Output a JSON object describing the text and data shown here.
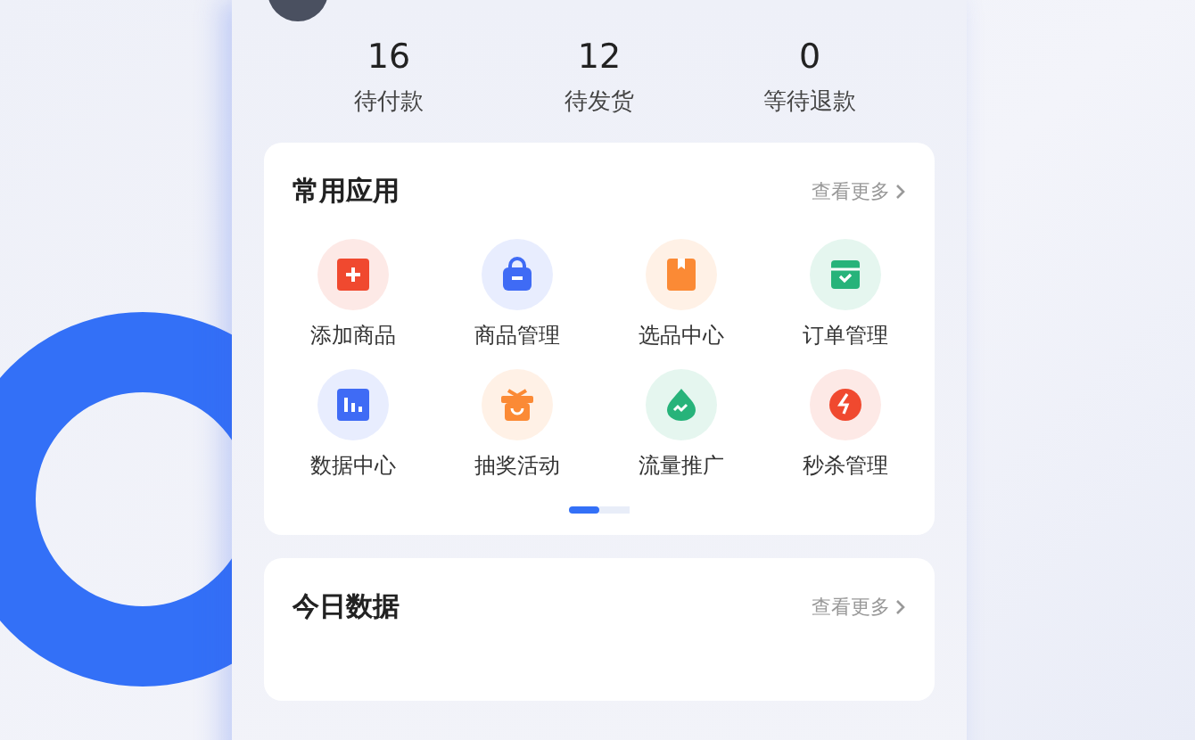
{
  "stats": [
    {
      "value": "16",
      "label": "待付款"
    },
    {
      "value": "12",
      "label": "待发货"
    },
    {
      "value": "0",
      "label": "等待退款"
    }
  ],
  "apps": {
    "title": "常用应用",
    "more": "查看更多",
    "items": [
      {
        "label": "添加商品",
        "kind": "add",
        "color": "#f0492f"
      },
      {
        "label": "商品管理",
        "kind": "bag",
        "color": "#3f6bf5"
      },
      {
        "label": "选品中心",
        "kind": "box",
        "color": "#fb8a35"
      },
      {
        "label": "订单管理",
        "kind": "order",
        "color": "#27b37a"
      },
      {
        "label": "数据中心",
        "kind": "chart",
        "color": "#3f6bf5"
      },
      {
        "label": "抽奖活动",
        "kind": "gift",
        "color": "#fb8a35"
      },
      {
        "label": "流量推广",
        "kind": "drop",
        "color": "#27b37a"
      },
      {
        "label": "秒杀管理",
        "kind": "flash",
        "color": "#f0492f"
      }
    ],
    "pages": [
      {
        "selected": true
      },
      {
        "selected": false
      }
    ]
  },
  "today": {
    "title": "今日数据",
    "more": "查看更多"
  }
}
